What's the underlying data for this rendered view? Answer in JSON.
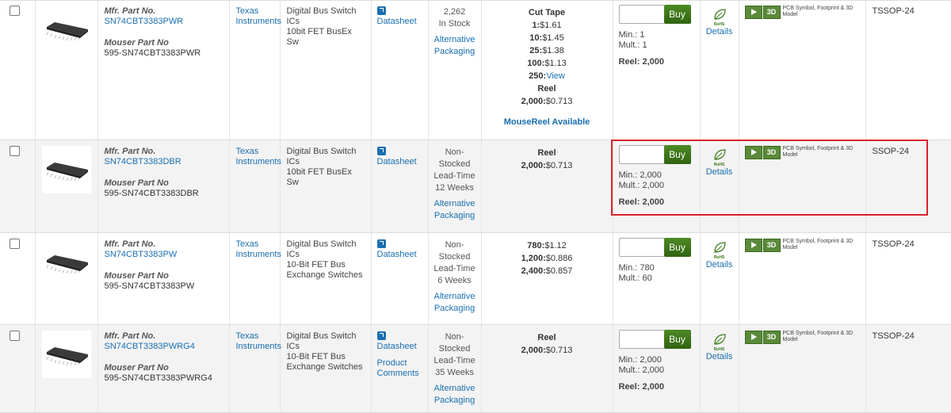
{
  "labels": {
    "mfr_part_no": "Mfr. Part No.",
    "mouser_part_no": "Mouser Part No",
    "datasheet": "Datasheet",
    "alt_packaging": "Alternative Packaging",
    "buy": "Buy",
    "details": "Details",
    "rohs": "RoHS",
    "ecad_3d": "3D",
    "ecad_text": "PCB Symbol, Footprint & 3D Model"
  },
  "colors": {
    "link": "#1a6fb1",
    "buy_button": "#3a7418",
    "highlight": "#d9232e",
    "alt_row": "#f3f3f3"
  },
  "rows": [
    {
      "mfr_part": "SN74CBT3383PWR",
      "mouser_part": "595-SN74CBT3383PWR",
      "manufacturer_line1": "Texas",
      "manufacturer_line2": "Instruments",
      "desc": [
        "Digital Bus Switch ICs",
        "10bit FET BusEx Sw"
      ],
      "extra_link": "",
      "stock": [
        "2,262",
        "In Stock"
      ],
      "pricing": [
        {
          "k": "",
          "v": "Cut Tape",
          "head": true
        },
        {
          "k": "1:",
          "v": "$1.61"
        },
        {
          "k": "10:",
          "v": "$1.45"
        },
        {
          "k": "25:",
          "v": "$1.38"
        },
        {
          "k": "100:",
          "v": "$1.13"
        },
        {
          "k": "250:",
          "v": "View",
          "link": true
        },
        {
          "k": "",
          "v": "Reel",
          "head": true
        },
        {
          "k": "2,000:",
          "v": "$0.713"
        }
      ],
      "price_note": "MouseReel Available",
      "min": "Min.: 1",
      "mult": "Mult.: 1",
      "reel": "Reel: 2,000",
      "package": "TSSOP-24"
    },
    {
      "mfr_part": "SN74CBT3383DBR",
      "mouser_part": "595-SN74CBT3383DBR",
      "manufacturer_line1": "Texas",
      "manufacturer_line2": "Instruments",
      "desc": [
        "Digital Bus Switch ICs",
        "10bit FET BusEx Sw"
      ],
      "extra_link": "",
      "stock": [
        "Non-",
        "Stocked",
        "Lead-Time",
        "12 Weeks"
      ],
      "pricing": [
        {
          "k": "",
          "v": "Reel",
          "head": true
        },
        {
          "k": "2,000:",
          "v": "$0.713"
        }
      ],
      "price_note": "",
      "min": "Min.: 2,000",
      "mult": "Mult.: 2,000",
      "reel": "Reel: 2,000",
      "package": "SSOP-24"
    },
    {
      "mfr_part": "SN74CBT3383PW",
      "mouser_part": "595-SN74CBT3383PW",
      "manufacturer_line1": "Texas",
      "manufacturer_line2": "Instruments",
      "desc": [
        "Digital Bus Switch ICs",
        "10-Bit FET Bus",
        "Exchange Switches"
      ],
      "extra_link": "",
      "stock": [
        "Non-",
        "Stocked",
        "Lead-Time",
        "6 Weeks"
      ],
      "pricing": [
        {
          "k": "780:",
          "v": "$1.12"
        },
        {
          "k": "1,200:",
          "v": "$0.886"
        },
        {
          "k": "2,400:",
          "v": "$0.857"
        }
      ],
      "price_note": "",
      "min": "Min.: 780",
      "mult": "Mult.: 60",
      "reel": "",
      "package": "TSSOP-24"
    },
    {
      "mfr_part": "SN74CBT3383PWRG4",
      "mouser_part": "595-SN74CBT3383PWRG4",
      "manufacturer_line1": "Texas",
      "manufacturer_line2": "Instruments",
      "desc": [
        "Digital Bus Switch ICs",
        "10-Bit FET Bus",
        "Exchange Switches"
      ],
      "extra_link": "Product Comments",
      "stock": [
        "Non-",
        "Stocked",
        "Lead-Time",
        "35 Weeks"
      ],
      "pricing": [
        {
          "k": "",
          "v": "Reel",
          "head": true
        },
        {
          "k": "2,000:",
          "v": "$0.713"
        }
      ],
      "price_note": "",
      "min": "Min.: 2,000",
      "mult": "Mult.: 2,000",
      "reel": "Reel: 2,000",
      "package": "TSSOP-24"
    }
  ]
}
